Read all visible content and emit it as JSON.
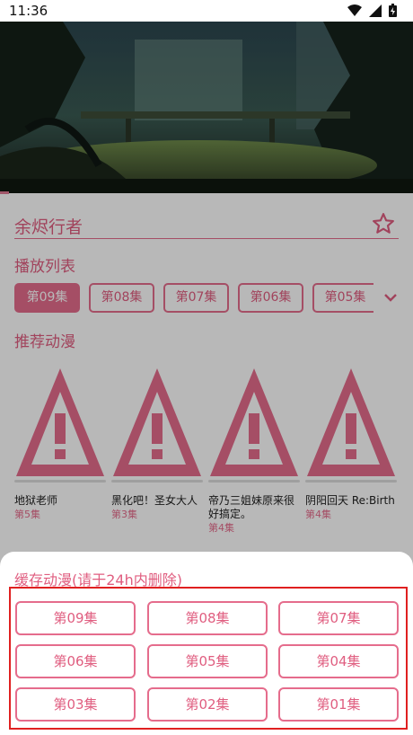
{
  "status_bar": {
    "time": "11:36"
  },
  "video": {
    "accent": "#e56c8c"
  },
  "anime": {
    "title": "余烬行者"
  },
  "playlist": {
    "label": "播放列表",
    "episodes": [
      "第09集",
      "第08集",
      "第07集",
      "第06集",
      "第05集"
    ],
    "active_index": 0
  },
  "recommend": {
    "label": "推荐动漫",
    "items": [
      {
        "name": "地狱老师",
        "ep": "第5集"
      },
      {
        "name": "黑化吧！圣女大人",
        "ep": "第3集"
      },
      {
        "name": "帝乃三姐妹原来很好搞定。",
        "ep": "第4集"
      },
      {
        "name": "阴阳回天 Re:Birth",
        "ep": "第4集"
      }
    ]
  },
  "cache_sheet": {
    "title": "缓存动漫(请于24h内删除)",
    "buttons": [
      "第09集",
      "第08集",
      "第07集",
      "第06集",
      "第05集",
      "第04集",
      "第03集",
      "第02集",
      "第01集"
    ]
  },
  "colors": {
    "accent": "#e56c8c",
    "highlight_border": "#e02020"
  }
}
